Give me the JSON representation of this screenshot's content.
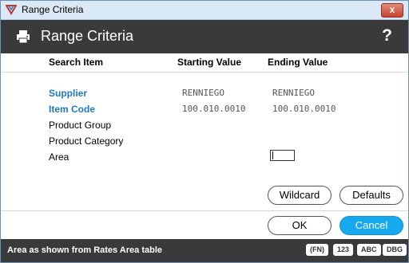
{
  "window": {
    "title": "Range Criteria",
    "close_label": "x"
  },
  "header": {
    "title": "Range Criteria",
    "help_label": "?"
  },
  "columns": {
    "search_item": "Search Item",
    "starting_value": "Starting Value",
    "ending_value": "Ending Value"
  },
  "rows": [
    {
      "label": "Supplier",
      "start": "RENNIEGO",
      "end": "RENNIEGO"
    },
    {
      "label": "Item Code",
      "start": "100.010.0010",
      "end": "100.010.0010"
    },
    {
      "label": "Product Group",
      "start": "",
      "end": ""
    },
    {
      "label": "Product Category",
      "start": "",
      "end": ""
    },
    {
      "label": "Area",
      "start": "",
      "end": ""
    }
  ],
  "buttons": {
    "wildcard": "Wildcard",
    "defaults": "Defaults",
    "ok": "OK",
    "cancel": "Cancel"
  },
  "status": {
    "text": "Area as shown from Rates Area table",
    "badges": [
      "(FN)",
      "123",
      "ABC",
      "DBG"
    ]
  },
  "colors": {
    "header_bg": "#3a3a3a",
    "accent_blue": "#17a9ee",
    "link_blue": "#1e7ac0"
  }
}
